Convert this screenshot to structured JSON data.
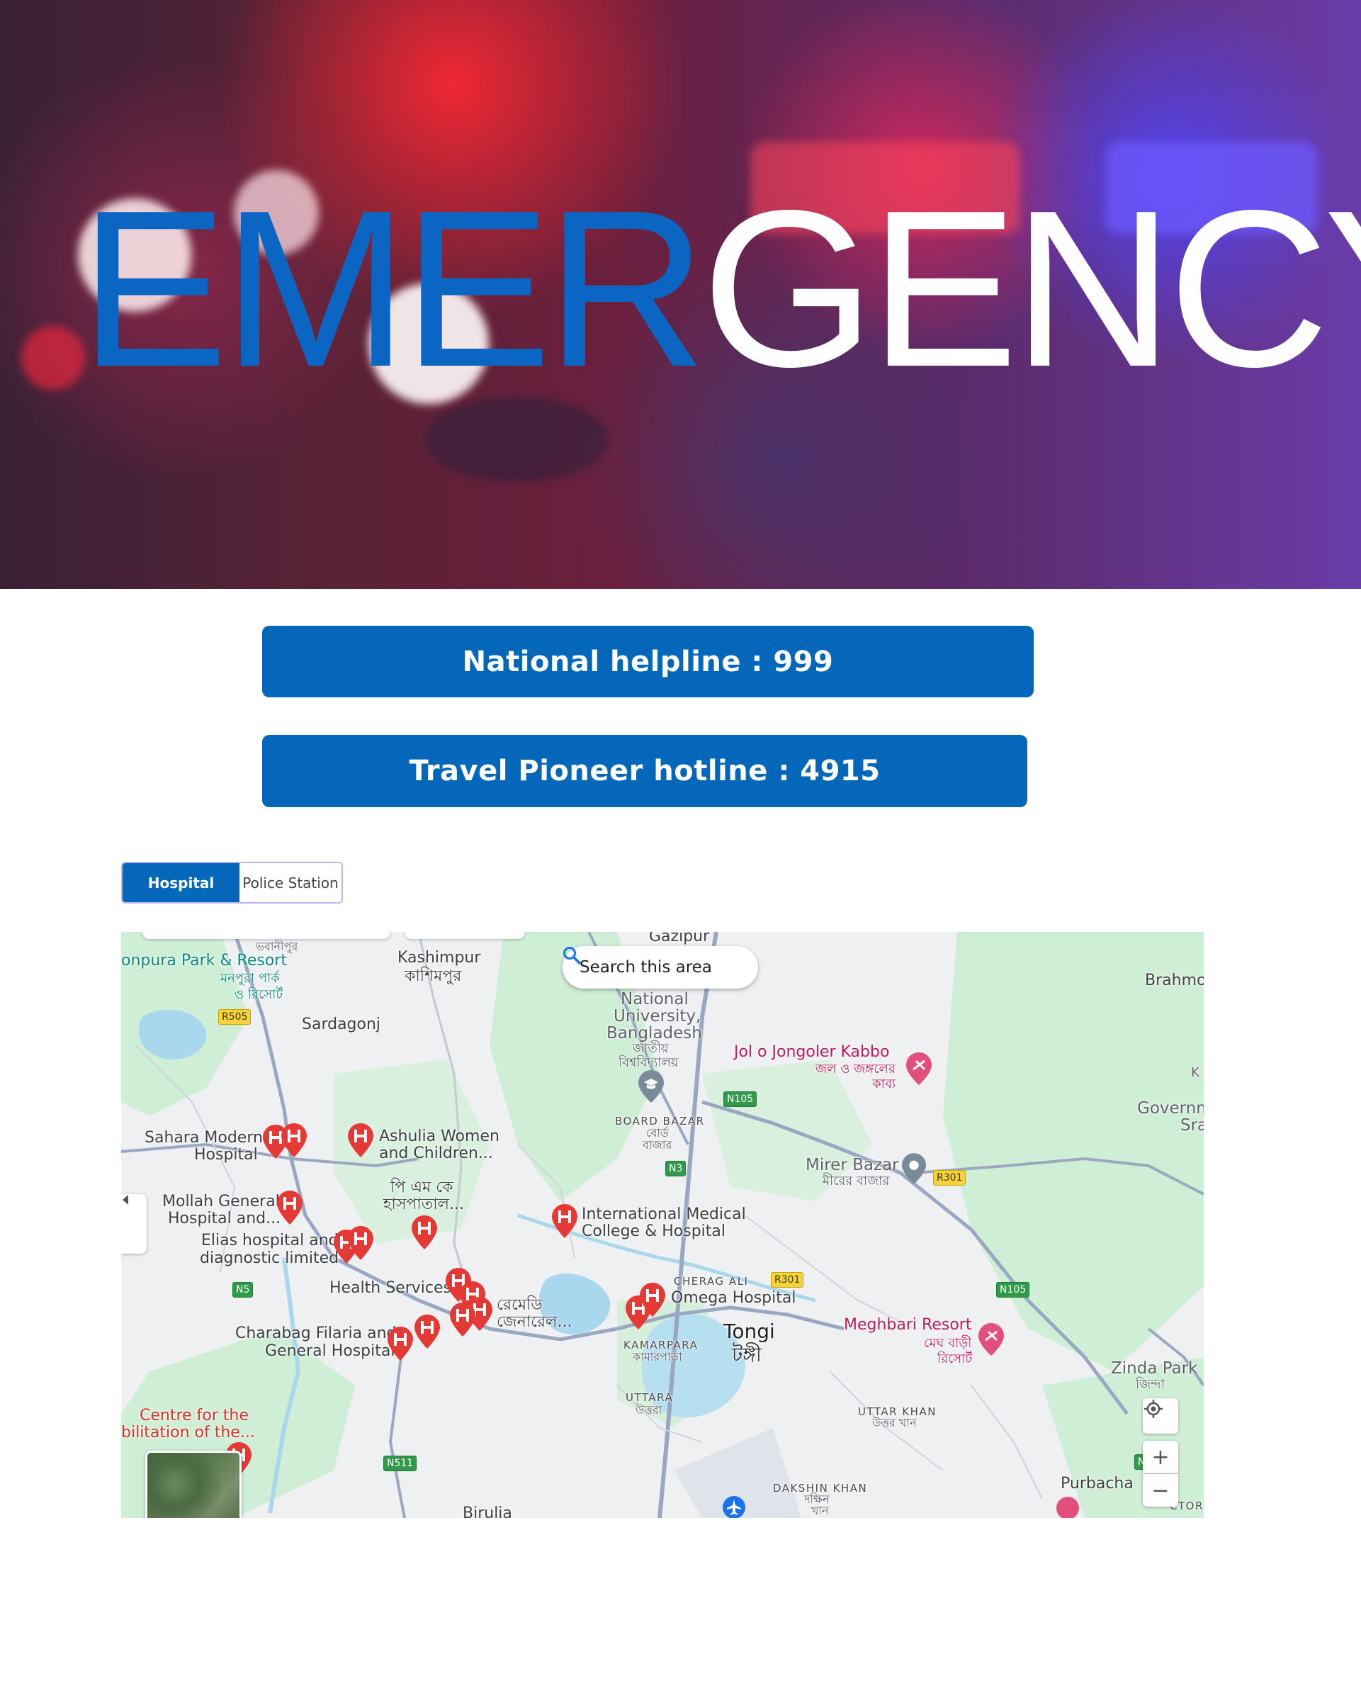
{
  "hero": {
    "title_part1": "EMER",
    "title_part2": "GENCY",
    "accent_color": "#0a66c2"
  },
  "hotlines": [
    {
      "label": "National helpline : 999"
    },
    {
      "label": "Travel Pioneer hotline : 4915"
    }
  ],
  "tabs": [
    {
      "label": "Hospital",
      "active": true
    },
    {
      "label": "Police Station",
      "active": false
    }
  ],
  "map": {
    "search_button": "Search this area",
    "zoom_in": "+",
    "zoom_out": "−",
    "places": {
      "gazipur": "Gazipur",
      "bhabanipur": "ভবানীপুর",
      "monpura": "onpura Park & Resort",
      "monpura_bn1": "মনপুরা পার্ক",
      "monpura_bn2": "ও রিসোর্ট",
      "kashimpur": "Kashimpur",
      "kashimpur_bn": "কাশিমপুর",
      "sardagonj": "Sardagonj",
      "national_univ1": "National",
      "national_univ2": "University,",
      "national_univ3": "Bangladesh",
      "national_univ_bn1": "জাতীয়",
      "national_univ_bn2": "বিশ্ববিদ্যালয়",
      "brahmo": "Brahmo",
      "jol_jongol": "Jol o Jongoler Kabbo",
      "jol_jongol_bn1": "জল ও জঙ্গলের",
      "jol_jongol_bn2": "কাব্য",
      "govt": "Governm",
      "sra": "Sra",
      "k": "K",
      "board_bazar": "BOARD BAZAR",
      "board_bazar_bn1": "বোর্ড",
      "board_bazar_bn2": "বাজার",
      "mirer_bazar": "Mirer Bazar",
      "mirer_bazar_bn": "মীরের বাজার",
      "sahara1": "Sahara Modern",
      "sahara2": "Hospital",
      "ashulia1": "Ashulia Women",
      "ashulia2": "and Children...",
      "pm_k1": "পি এম কে",
      "pm_k2": "হাসপাতাল...",
      "mollah1": "Mollah General",
      "mollah2": "Hospital and...",
      "elias1": "Elias hospital and",
      "elias2": "diagnostic limited",
      "imc1": "International Medical",
      "imc2": "College & Hospital",
      "health": "Health Services",
      "remedy1": "রেমেডি",
      "remedy2": "জেনারেল...",
      "cherag_ali": "CHERAG ALI",
      "omega": "Omega Hospital",
      "charabag1": "Charabag Filaria and",
      "charabag2": "General Hospital",
      "kamarpara": "KAMARPARA",
      "kamarpara_bn": "কামারপাড়া",
      "tongi": "Tongi",
      "tongi_bn": "টঙ্গী",
      "meghbari": "Meghbari Resort",
      "meghbari_bn1": "মেঘ বাড়ী",
      "meghbari_bn2": "রিসোর্ট",
      "zinda": "Zinda Park",
      "zinda_bn": "জিন্দা",
      "centre1": "Centre for the",
      "centre2": "bilitation of the...",
      "uttara": "UTTARA",
      "uttara_bn": "উত্তরা",
      "uttar_khan": "UTTAR KHAN",
      "uttar_khan_bn": "উত্তর খান",
      "dakshin_khan": "DAKSHIN KHAN",
      "dakshin_khan_bn1": "দক্ষিন",
      "dakshin_khan_bn2": "খান",
      "purbacha": "Purbacha",
      "birulia": "Birulia",
      "ctor": "CTOR"
    },
    "roads": {
      "r505": "R505",
      "n105a": "N105",
      "n3": "N3",
      "r301a": "R301",
      "r301b": "R301",
      "n5": "N5",
      "n105b": "N105",
      "n511": "N511",
      "n_right": "N"
    }
  }
}
